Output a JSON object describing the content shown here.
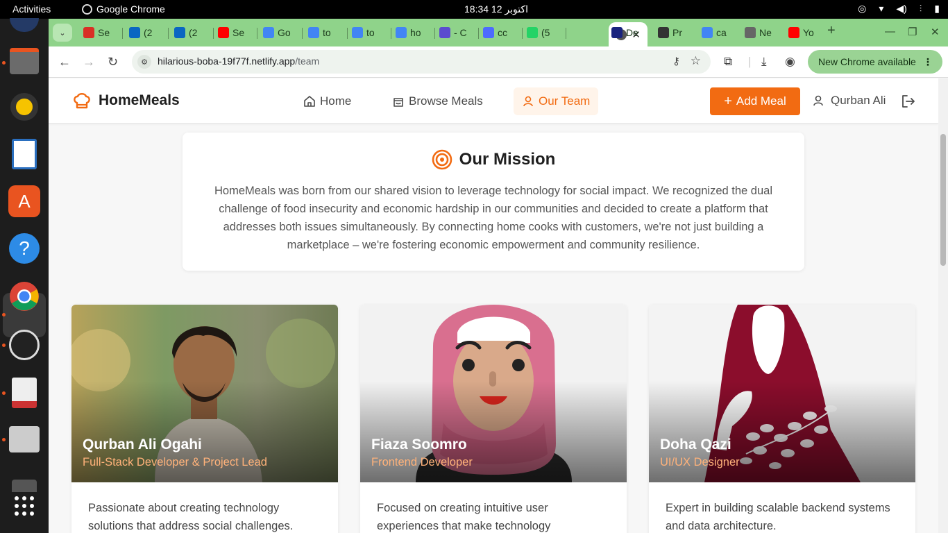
{
  "system": {
    "activities": "Activities",
    "app_name": "Google Chrome",
    "clock": "18:34  12 اکتوبر"
  },
  "browser": {
    "tabs": [
      {
        "label": "Se",
        "icon": "gmail-icon",
        "color": "#d93025"
      },
      {
        "label": "(2",
        "icon": "linkedin-icon",
        "color": "#0a66c2"
      },
      {
        "label": "(2",
        "icon": "linkedin-icon",
        "color": "#0a66c2"
      },
      {
        "label": "Se",
        "icon": "youtube-icon",
        "color": "#ff0000"
      },
      {
        "label": "Go",
        "icon": "gemini-icon",
        "color": "#4285f4"
      },
      {
        "label": "to",
        "icon": "google-icon",
        "color": "#4285f4"
      },
      {
        "label": "to",
        "icon": "google-icon",
        "color": "#4285f4"
      },
      {
        "label": "ho",
        "icon": "google-icon",
        "color": "#4285f4"
      },
      {
        "label": "- C",
        "icon": "copilot-icon",
        "color": "#5b4ccf"
      },
      {
        "label": "cc",
        "icon": "deepseek-icon",
        "color": "#4d6bfe"
      },
      {
        "label": "(5",
        "icon": "whatsapp-icon",
        "color": "#25d366"
      }
    ],
    "tabs_right": [
      {
        "label": "De",
        "icon": "d-icon",
        "color": "#1a237e"
      },
      {
        "label": "Pr",
        "icon": "openai-icon",
        "color": "#333333"
      },
      {
        "label": "ca",
        "icon": "google-icon",
        "color": "#4285f4"
      },
      {
        "label": "Ne",
        "icon": "chrome-icon",
        "color": "#666666"
      },
      {
        "label": "Yo",
        "icon": "youtube-icon",
        "color": "#ff0000"
      }
    ],
    "url_host": "hilarious-boba-19f77f.netlify.app",
    "url_path": "/team",
    "update_label": "New Chrome available"
  },
  "site": {
    "brand": "HomeMeals",
    "nav": {
      "home": "Home",
      "browse": "Browse Meals",
      "team": "Our Team"
    },
    "add_meal": "Add Meal",
    "user_name": "Qurban Ali",
    "accent": "#f26b12"
  },
  "mission": {
    "title": "Our Mission",
    "text": "HomeMeals was born from our shared vision to leverage technology for social impact. We recognized the dual challenge of food insecurity and economic hardship in our communities and decided to create a platform that addresses both issues simultaneously. By connecting home cooks with customers, we're not just building a marketplace – we're fostering economic empowerment and community resilience."
  },
  "team": [
    {
      "name": "Qurban Ali Ogahi",
      "role": "Full-Stack Developer & Project Lead",
      "bio": "Passionate about creating technology solutions that address social challenges."
    },
    {
      "name": "Fiaza Soomro",
      "role": "Frontend Developer",
      "bio": "Focused on creating intuitive user experiences that make technology"
    },
    {
      "name": "Doha Qazi",
      "role": "UI/UX Designer",
      "bio": "Expert in building scalable backend systems and data architecture."
    }
  ]
}
